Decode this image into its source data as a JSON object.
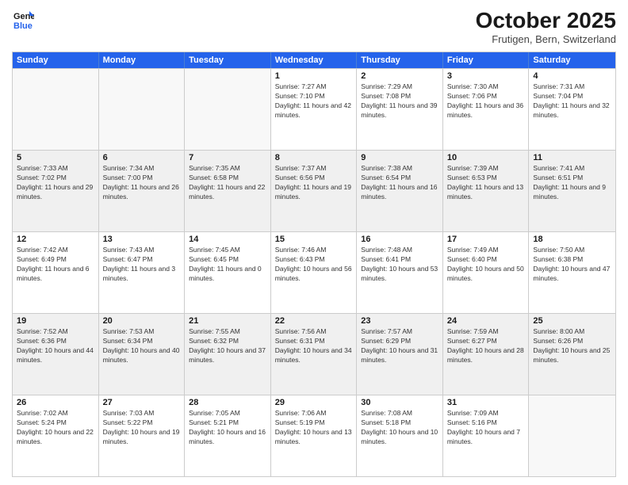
{
  "header": {
    "logo_line1": "General",
    "logo_line2": "Blue",
    "month": "October 2025",
    "location": "Frutigen, Bern, Switzerland"
  },
  "days_of_week": [
    "Sunday",
    "Monday",
    "Tuesday",
    "Wednesday",
    "Thursday",
    "Friday",
    "Saturday"
  ],
  "weeks": [
    [
      {
        "day": "",
        "empty": true
      },
      {
        "day": "",
        "empty": true
      },
      {
        "day": "",
        "empty": true
      },
      {
        "day": "1",
        "sunrise": "7:27 AM",
        "sunset": "7:10 PM",
        "daylight": "11 hours and 42 minutes."
      },
      {
        "day": "2",
        "sunrise": "7:29 AM",
        "sunset": "7:08 PM",
        "daylight": "11 hours and 39 minutes."
      },
      {
        "day": "3",
        "sunrise": "7:30 AM",
        "sunset": "7:06 PM",
        "daylight": "11 hours and 36 minutes."
      },
      {
        "day": "4",
        "sunrise": "7:31 AM",
        "sunset": "7:04 PM",
        "daylight": "11 hours and 32 minutes."
      }
    ],
    [
      {
        "day": "5",
        "sunrise": "7:33 AM",
        "sunset": "7:02 PM",
        "daylight": "11 hours and 29 minutes."
      },
      {
        "day": "6",
        "sunrise": "7:34 AM",
        "sunset": "7:00 PM",
        "daylight": "11 hours and 26 minutes."
      },
      {
        "day": "7",
        "sunrise": "7:35 AM",
        "sunset": "6:58 PM",
        "daylight": "11 hours and 22 minutes."
      },
      {
        "day": "8",
        "sunrise": "7:37 AM",
        "sunset": "6:56 PM",
        "daylight": "11 hours and 19 minutes."
      },
      {
        "day": "9",
        "sunrise": "7:38 AM",
        "sunset": "6:54 PM",
        "daylight": "11 hours and 16 minutes."
      },
      {
        "day": "10",
        "sunrise": "7:39 AM",
        "sunset": "6:53 PM",
        "daylight": "11 hours and 13 minutes."
      },
      {
        "day": "11",
        "sunrise": "7:41 AM",
        "sunset": "6:51 PM",
        "daylight": "11 hours and 9 minutes."
      }
    ],
    [
      {
        "day": "12",
        "sunrise": "7:42 AM",
        "sunset": "6:49 PM",
        "daylight": "11 hours and 6 minutes."
      },
      {
        "day": "13",
        "sunrise": "7:43 AM",
        "sunset": "6:47 PM",
        "daylight": "11 hours and 3 minutes."
      },
      {
        "day": "14",
        "sunrise": "7:45 AM",
        "sunset": "6:45 PM",
        "daylight": "11 hours and 0 minutes."
      },
      {
        "day": "15",
        "sunrise": "7:46 AM",
        "sunset": "6:43 PM",
        "daylight": "10 hours and 56 minutes."
      },
      {
        "day": "16",
        "sunrise": "7:48 AM",
        "sunset": "6:41 PM",
        "daylight": "10 hours and 53 minutes."
      },
      {
        "day": "17",
        "sunrise": "7:49 AM",
        "sunset": "6:40 PM",
        "daylight": "10 hours and 50 minutes."
      },
      {
        "day": "18",
        "sunrise": "7:50 AM",
        "sunset": "6:38 PM",
        "daylight": "10 hours and 47 minutes."
      }
    ],
    [
      {
        "day": "19",
        "sunrise": "7:52 AM",
        "sunset": "6:36 PM",
        "daylight": "10 hours and 44 minutes."
      },
      {
        "day": "20",
        "sunrise": "7:53 AM",
        "sunset": "6:34 PM",
        "daylight": "10 hours and 40 minutes."
      },
      {
        "day": "21",
        "sunrise": "7:55 AM",
        "sunset": "6:32 PM",
        "daylight": "10 hours and 37 minutes."
      },
      {
        "day": "22",
        "sunrise": "7:56 AM",
        "sunset": "6:31 PM",
        "daylight": "10 hours and 34 minutes."
      },
      {
        "day": "23",
        "sunrise": "7:57 AM",
        "sunset": "6:29 PM",
        "daylight": "10 hours and 31 minutes."
      },
      {
        "day": "24",
        "sunrise": "7:59 AM",
        "sunset": "6:27 PM",
        "daylight": "10 hours and 28 minutes."
      },
      {
        "day": "25",
        "sunrise": "8:00 AM",
        "sunset": "6:26 PM",
        "daylight": "10 hours and 25 minutes."
      }
    ],
    [
      {
        "day": "26",
        "sunrise": "7:02 AM",
        "sunset": "5:24 PM",
        "daylight": "10 hours and 22 minutes."
      },
      {
        "day": "27",
        "sunrise": "7:03 AM",
        "sunset": "5:22 PM",
        "daylight": "10 hours and 19 minutes."
      },
      {
        "day": "28",
        "sunrise": "7:05 AM",
        "sunset": "5:21 PM",
        "daylight": "10 hours and 16 minutes."
      },
      {
        "day": "29",
        "sunrise": "7:06 AM",
        "sunset": "5:19 PM",
        "daylight": "10 hours and 13 minutes."
      },
      {
        "day": "30",
        "sunrise": "7:08 AM",
        "sunset": "5:18 PM",
        "daylight": "10 hours and 10 minutes."
      },
      {
        "day": "31",
        "sunrise": "7:09 AM",
        "sunset": "5:16 PM",
        "daylight": "10 hours and 7 minutes."
      },
      {
        "day": "",
        "empty": true
      }
    ]
  ]
}
